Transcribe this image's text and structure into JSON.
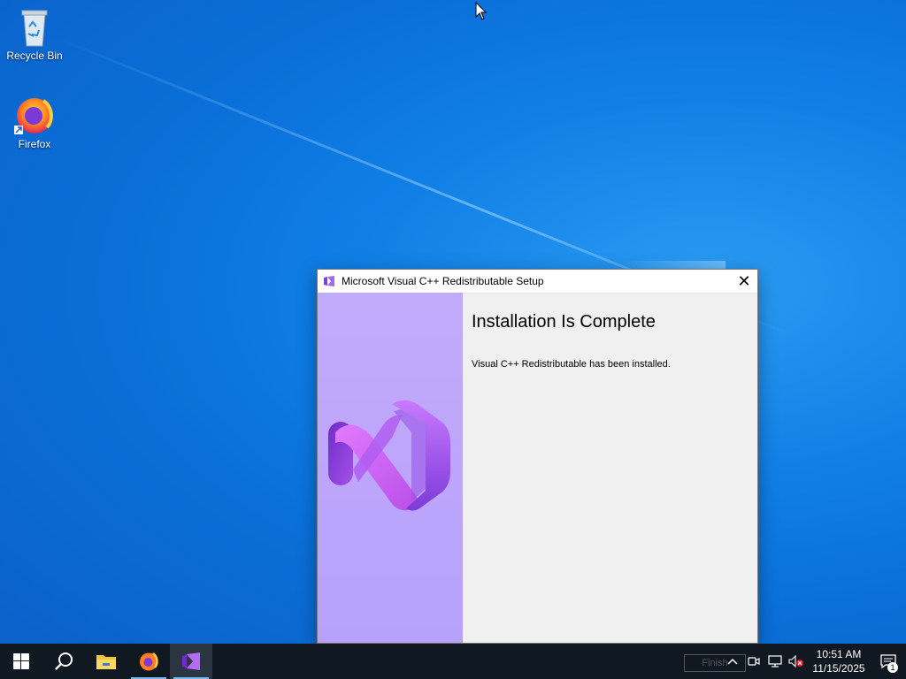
{
  "desktop": {
    "icons": [
      {
        "label": "Recycle Bin",
        "icon": "recycle-bin-icon"
      },
      {
        "label": "Firefox",
        "icon": "firefox-icon"
      }
    ]
  },
  "dialog": {
    "title": "Microsoft Visual C++ Redistributable Setup",
    "close_label": "✕",
    "heading": "Installation Is Complete",
    "message": "Visual C++ Redistributable has been installed.",
    "finish_label": "Finish"
  },
  "taskbar": {
    "apps": [
      {
        "name": "Start",
        "icon": "windows-start-icon"
      },
      {
        "name": "Search",
        "icon": "search-icon"
      },
      {
        "name": "File Explorer",
        "icon": "folder-icon"
      },
      {
        "name": "Firefox",
        "icon": "firefox-icon"
      },
      {
        "name": "Visual Studio Installer",
        "icon": "visual-studio-icon"
      }
    ],
    "tray": {
      "time": "10:51 AM",
      "date": "11/15/2025",
      "notification_count": "1"
    }
  },
  "colors": {
    "desktop_bg": "#0a6fd8",
    "side_panel": "#b9a3fb",
    "taskbar": "#101822"
  }
}
